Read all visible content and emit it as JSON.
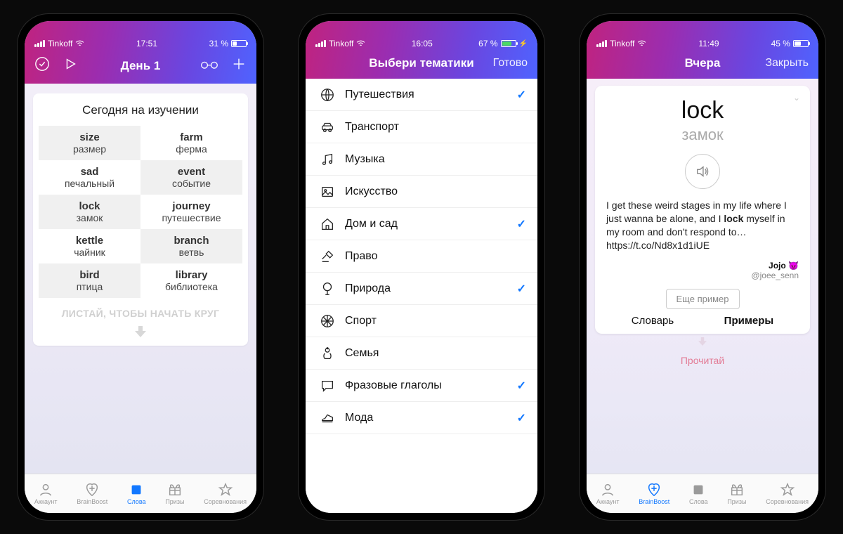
{
  "screen1": {
    "status": {
      "carrier": "Tinkoff",
      "time": "17:51",
      "battery_pct": "31 %",
      "battery_fill": "31%"
    },
    "nav": {
      "title": "День 1"
    },
    "card_title": "Сегодня на изучении",
    "words": [
      {
        "en": "size",
        "ru": "размер"
      },
      {
        "en": "farm",
        "ru": "ферма"
      },
      {
        "en": "sad",
        "ru": "печальный"
      },
      {
        "en": "event",
        "ru": "событие"
      },
      {
        "en": "lock",
        "ru": "замок"
      },
      {
        "en": "journey",
        "ru": "путешествие"
      },
      {
        "en": "kettle",
        "ru": "чайник"
      },
      {
        "en": "branch",
        "ru": "ветвь"
      },
      {
        "en": "bird",
        "ru": "птица"
      },
      {
        "en": "library",
        "ru": "библиотека"
      }
    ],
    "swipe_hint": "ЛИСТАЙ, ЧТОБЫ НАЧАТЬ КРУГ",
    "tabs": [
      "Аккаунт",
      "BrainBoost",
      "Слова",
      "Призы",
      "Соревнования"
    ],
    "active_tab": 2
  },
  "screen2": {
    "status": {
      "carrier": "Tinkoff",
      "time": "16:05",
      "battery_pct": "67 %",
      "battery_fill": "67%"
    },
    "nav": {
      "title": "Выбери тематики",
      "done": "Готово"
    },
    "topics": [
      {
        "icon": "globe",
        "label": "Путешествия",
        "checked": true
      },
      {
        "icon": "car",
        "label": "Транспорт",
        "checked": false
      },
      {
        "icon": "music",
        "label": "Музыка",
        "checked": false
      },
      {
        "icon": "image",
        "label": "Искусство",
        "checked": false
      },
      {
        "icon": "home",
        "label": "Дом и сад",
        "checked": true
      },
      {
        "icon": "gavel",
        "label": "Право",
        "checked": false
      },
      {
        "icon": "tree",
        "label": "Природа",
        "checked": true
      },
      {
        "icon": "ball",
        "label": "Спорт",
        "checked": false
      },
      {
        "icon": "baby",
        "label": "Семья",
        "checked": false
      },
      {
        "icon": "chat",
        "label": "Фразовые глаголы",
        "checked": true
      },
      {
        "icon": "shoe",
        "label": "Мода",
        "checked": true
      }
    ]
  },
  "screen3": {
    "status": {
      "carrier": "Tinkoff",
      "time": "11:49",
      "battery_pct": "45 %",
      "battery_fill": "45%"
    },
    "nav": {
      "title": "Вчера",
      "close": "Закрыть"
    },
    "word": "lock",
    "translation": "замок",
    "example_pre": "I get these weird stages in my life where I just wanna be alone, and I ",
    "example_bold": "lock",
    "example_post": " myself in my room and don't respond to…",
    "example_link": "https://t.co/Nd8x1d1iUE",
    "author_name": "Jojo 😈",
    "author_handle": "@joee_senn",
    "more_btn": "Еще пример",
    "seg_dict": "Словарь",
    "seg_examples": "Примеры",
    "read_hint": "Прочитай",
    "tabs": [
      "Аккаунт",
      "BrainBoost",
      "Слова",
      "Призы",
      "Соревнования"
    ],
    "active_tab": 1
  }
}
